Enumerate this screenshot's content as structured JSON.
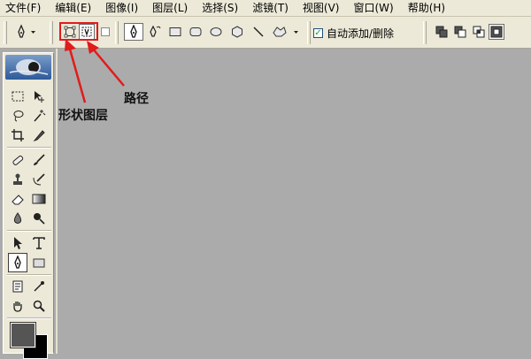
{
  "menu": [
    "文件(F)",
    "编辑(E)",
    "图像(I)",
    "图层(L)",
    "选择(S)",
    "滤镜(T)",
    "视图(V)",
    "窗口(W)",
    "帮助(H)"
  ],
  "options": {
    "auto_add_delete_label": "自动添加/删除",
    "auto_add_delete_checked": true
  },
  "annotations": {
    "shape_layers": "形状图层",
    "paths": "路径"
  },
  "colors": {
    "annotation": "#e21b1b",
    "canvas": "#ababab",
    "foreground": "#555555",
    "background": "#000000"
  }
}
